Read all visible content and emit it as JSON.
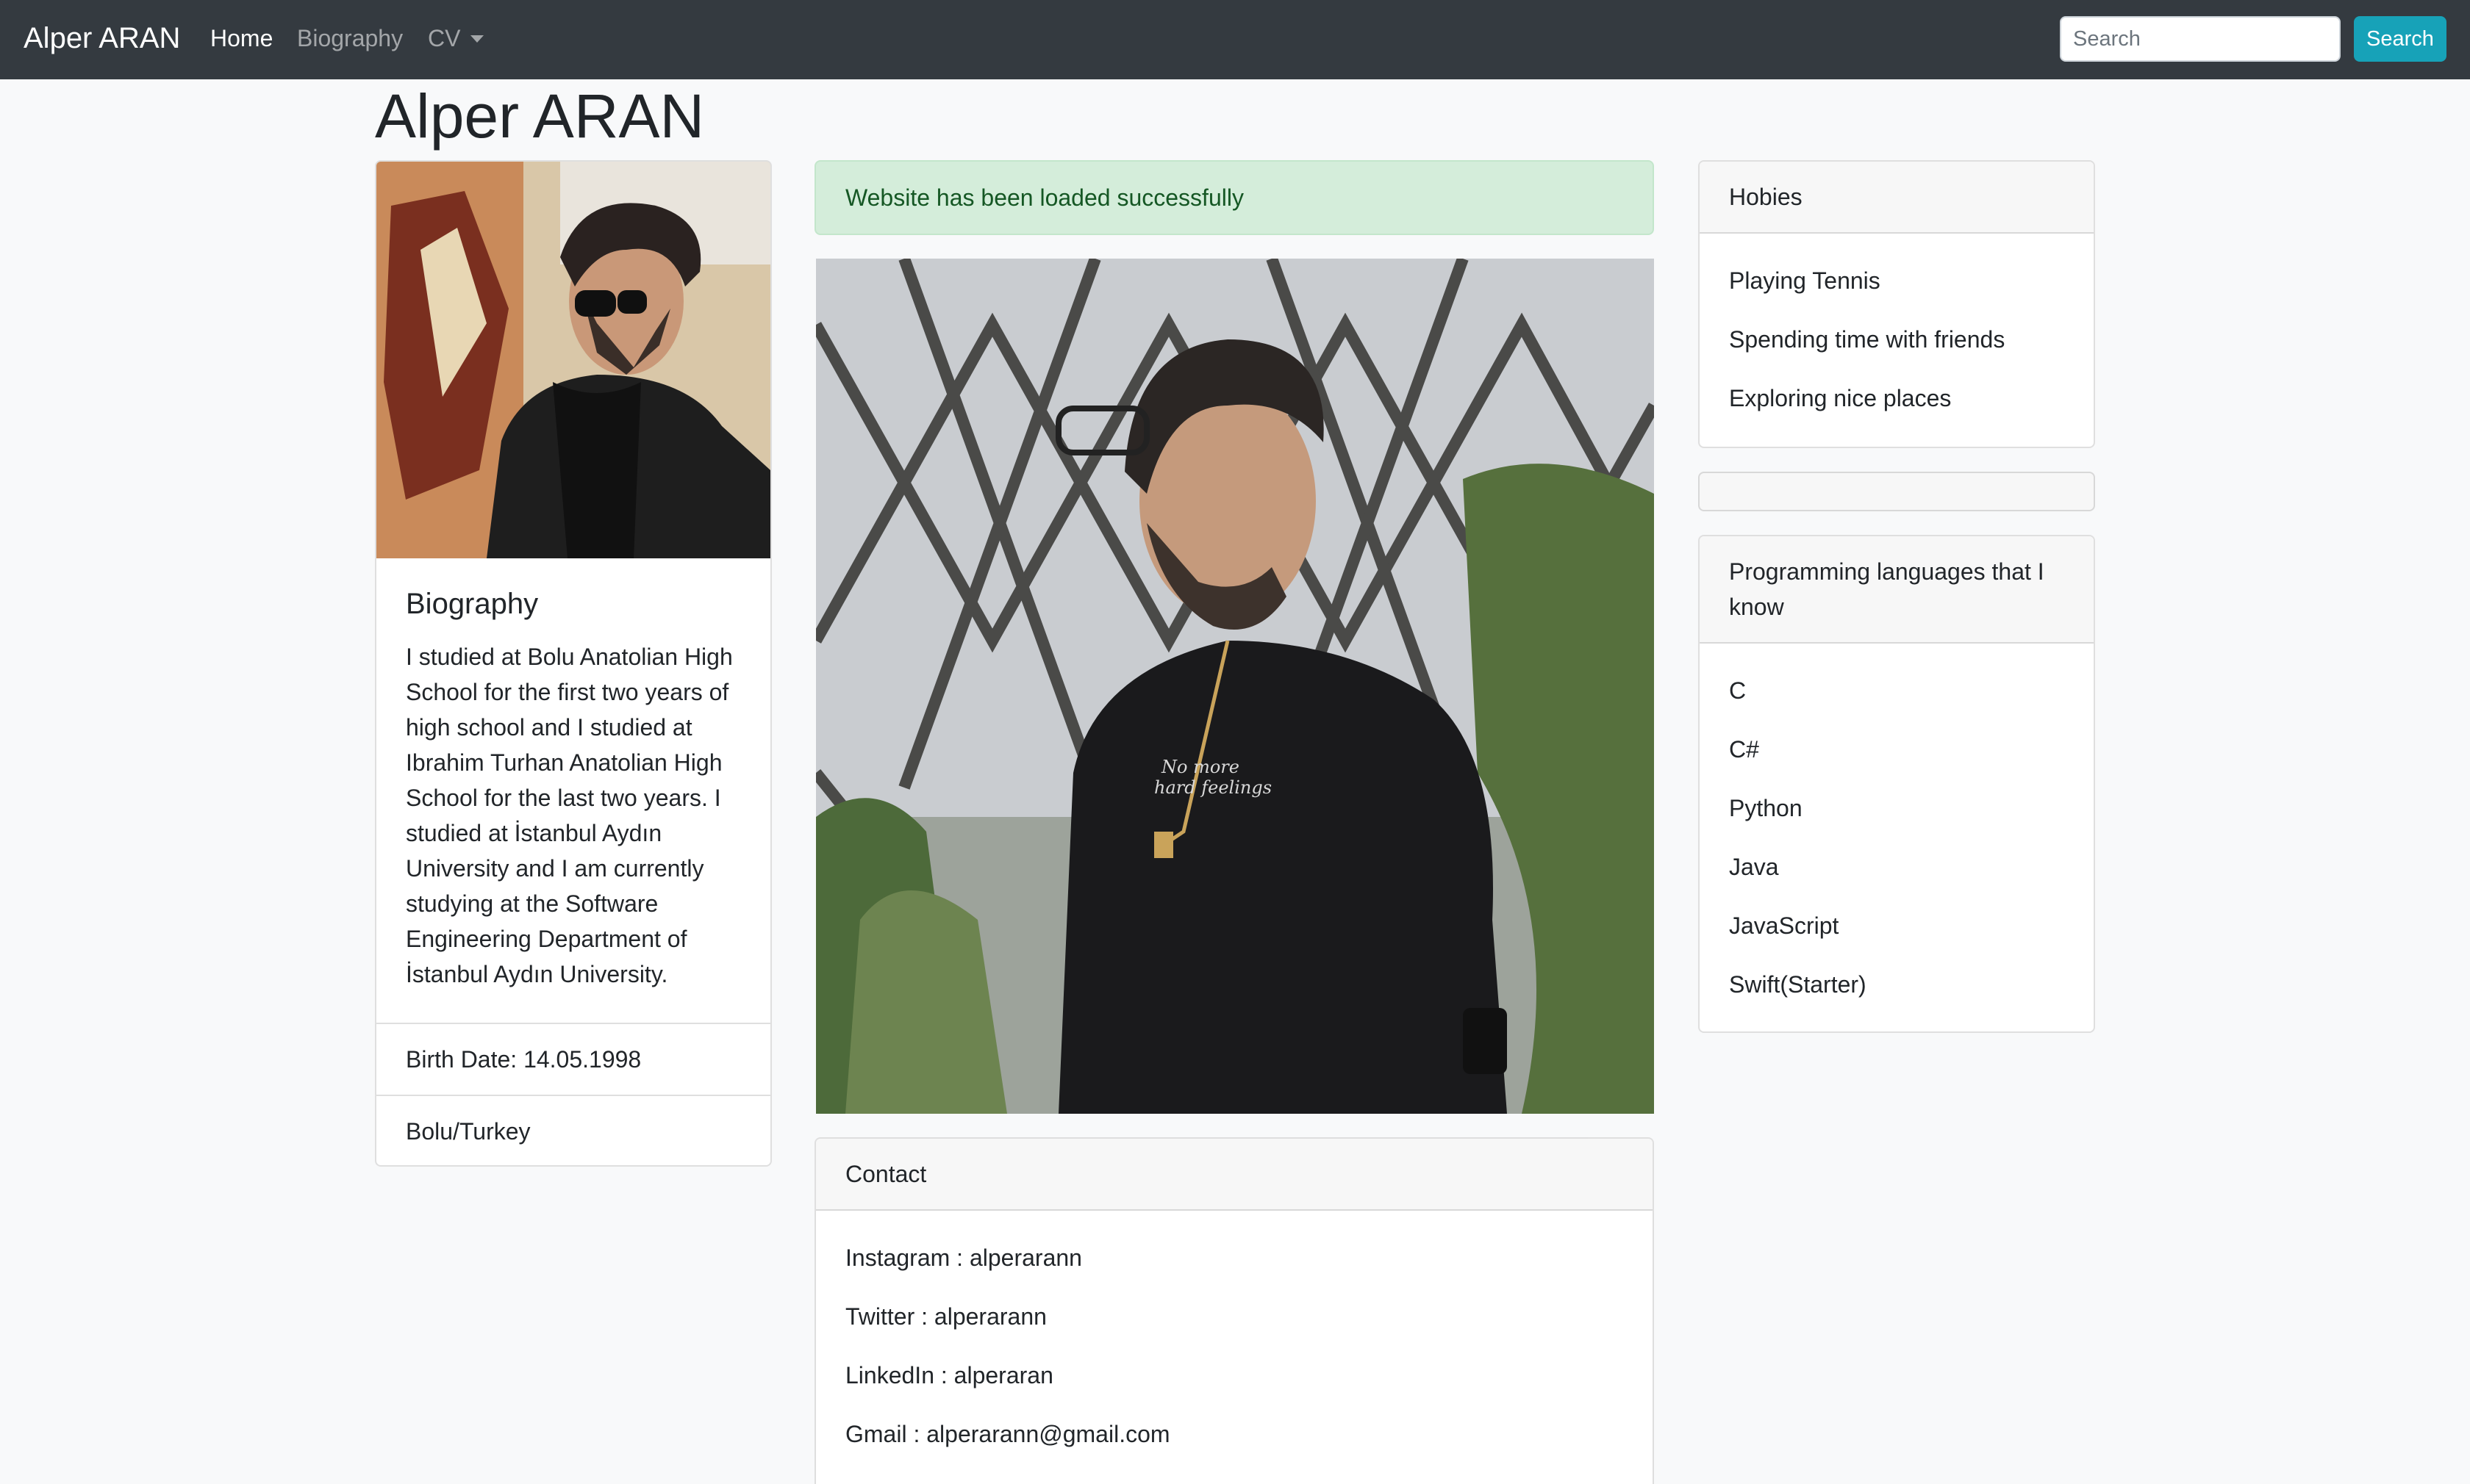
{
  "navbar": {
    "brand": "Alper ARAN",
    "links": [
      {
        "label": "Home",
        "active": true
      },
      {
        "label": "Biography",
        "active": false
      },
      {
        "label": "CV",
        "dropdown": true
      }
    ],
    "search_placeholder": "Search",
    "search_button": "Search"
  },
  "page_title": "Alper ARAN",
  "biography_card": {
    "title": "Biography",
    "text": "I studied at Bolu Anatolian High School for the first two years of high school and I studied at Ibrahim Turhan Anatolian High School for the last two years. I studied at İstanbul Aydın University and I am currently studying at the Software Engineering Department of İstanbul Aydın University.",
    "birth_date": "Birth Date: 14.05.1998",
    "location": "Bolu/Turkey"
  },
  "alert": {
    "text": "Website has been loaded successfully",
    "color": "#d4edda"
  },
  "contact": {
    "header": "Contact",
    "items": [
      "Instagram : alperarann",
      "Twitter : alperarann",
      "LinkedIn : alperaran",
      "Gmail : alperarann@gmail.com"
    ]
  },
  "hobbies": {
    "header": "Hobies",
    "items": [
      "Playing Tennis",
      "Spending time with friends",
      "Exploring nice places"
    ]
  },
  "languages": {
    "header": "Programming languages that I know",
    "items": [
      "C",
      "C#",
      "Python",
      "Java",
      "JavaScript",
      "Swift(Starter)"
    ]
  },
  "colors": {
    "navbar": "#343a40",
    "search_button": "#17a2b8",
    "background": "#f8f9fa"
  }
}
